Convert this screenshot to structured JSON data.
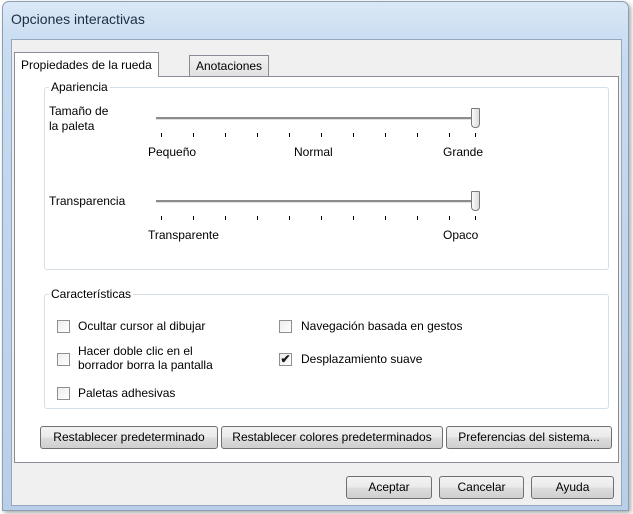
{
  "window": {
    "title": "Opciones interactivas"
  },
  "tabs": [
    {
      "label": "Propiedades de la rueda",
      "selected": true
    },
    {
      "label": "Anotaciones",
      "selected": false
    }
  ],
  "appearance": {
    "legend": "Apariencia",
    "palette_size": {
      "label_line1": "Tamaño de",
      "label_line2": "la paleta",
      "marks": [
        "Pequeño",
        "Normal",
        "Grande"
      ],
      "value_fraction": 1.0
    },
    "transparency": {
      "label": "Transparencia",
      "marks": [
        "Transparente",
        "Opaco"
      ],
      "value_fraction": 1.0
    }
  },
  "features": {
    "legend": "Características",
    "hide_cursor": {
      "label": "Ocultar cursor al dibujar",
      "checked": false
    },
    "double_click": {
      "label_line1": "Hacer doble clic en el",
      "label_line2": "borrador borra la pantalla",
      "checked": false
    },
    "sticky_palettes": {
      "label": "Paletas adhesivas",
      "checked": false
    },
    "gesture_nav": {
      "label": "Navegación basada en gestos",
      "checked": false
    },
    "smooth_scroll": {
      "label": "Desplazamiento suave",
      "checked": true
    }
  },
  "panel_buttons": {
    "reset_default": "Restablecer predeterminado",
    "reset_colors": "Restablecer colores predeterminados",
    "system_prefs": "Preferencias del sistema..."
  },
  "dialog_buttons": {
    "ok": "Aceptar",
    "cancel": "Cancelar",
    "help": "Ayuda"
  },
  "check_glyph": "✔"
}
